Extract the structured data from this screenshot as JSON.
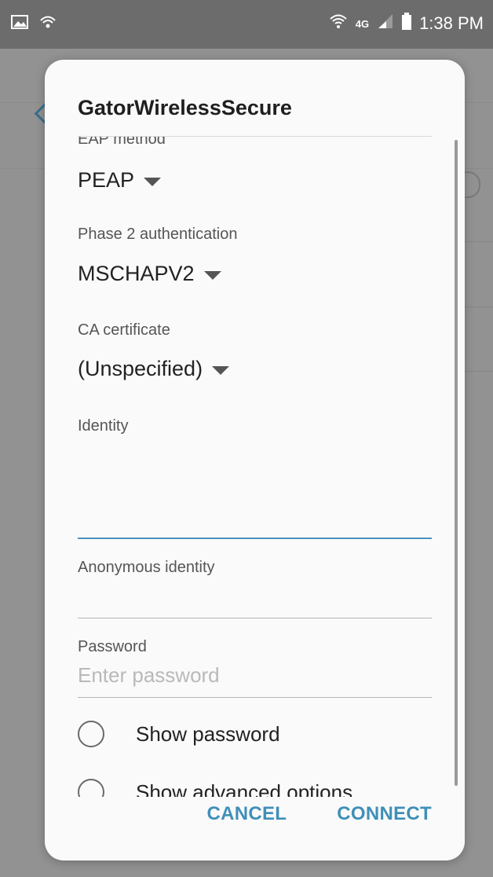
{
  "status_bar": {
    "time": "1:38 PM",
    "network_label": "4G",
    "left_icons": [
      "image-icon",
      "wifi-call-icon"
    ],
    "right_icons": [
      "wifi-icon",
      "4g-lte-icon",
      "signal-icon",
      "battery-icon"
    ]
  },
  "dialog": {
    "title": "GatorWirelessSecure",
    "eap_method": {
      "label": "EAP method",
      "value": "PEAP"
    },
    "phase2": {
      "label": "Phase 2 authentication",
      "value": "MSCHAPV2"
    },
    "ca_certificate": {
      "label": "CA certificate",
      "value": "(Unspecified)"
    },
    "identity": {
      "label": "Identity",
      "value": ""
    },
    "anonymous_identity": {
      "label": "Anonymous identity",
      "value": ""
    },
    "password": {
      "label": "Password",
      "value": "",
      "placeholder": "Enter password"
    },
    "show_password": {
      "label": "Show password",
      "checked": false
    },
    "show_advanced": {
      "label": "Show advanced options",
      "checked": false
    },
    "buttons": {
      "cancel": "CANCEL",
      "connect": "CONNECT"
    }
  },
  "colors": {
    "accent": "#3f8fb8",
    "focus_line": "#4a93be",
    "dialog_bg": "#fafafa",
    "scrim": "#929292"
  }
}
